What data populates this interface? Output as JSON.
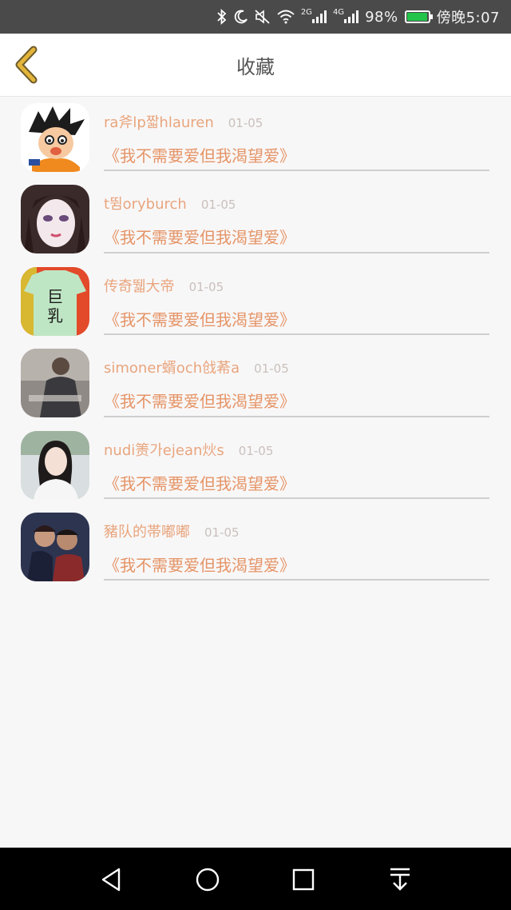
{
  "status_bar": {
    "network_2g": "2G",
    "network_4g": "4G",
    "battery_percent": "98%",
    "battery_level": 0.98,
    "time": "傍晚5:07"
  },
  "header": {
    "title": "收藏"
  },
  "favorites": [
    {
      "name": "ra斧lp짧hlauren",
      "date": "01-05",
      "title": "《我不需要爱但我渴望爱》",
      "avatar": "cartoon-boy"
    },
    {
      "name": "t뜀oryburch",
      "date": "01-05",
      "title": "《我不需要爱但我渴望爱》",
      "avatar": "girl-anime"
    },
    {
      "name": "传奇뛟大帝",
      "date": "01-05",
      "title": "《我不需要爱但我渴望爱》",
      "avatar": "shirt-text"
    },
    {
      "name": "simoner蝑och戗莃a",
      "date": "01-05",
      "title": "《我不需要爱但我渴望爱》",
      "avatar": "man-photo"
    },
    {
      "name": "nudi箦가ejean炏s",
      "date": "01-05",
      "title": "《我不需要爱但我渴望爱》",
      "avatar": "woman-photo"
    },
    {
      "name": "豬队的帯嘟嘟",
      "date": "01-05",
      "title": "《我不需要爱但我渴望爱》",
      "avatar": "couple-photo"
    }
  ],
  "avatar_texts": {
    "shirt_line1": "巨",
    "shirt_line2": "乳"
  },
  "colors": {
    "accent_name": "#e8a57d",
    "accent_title": "#e59466",
    "back_arrow": "#e3b43a"
  }
}
